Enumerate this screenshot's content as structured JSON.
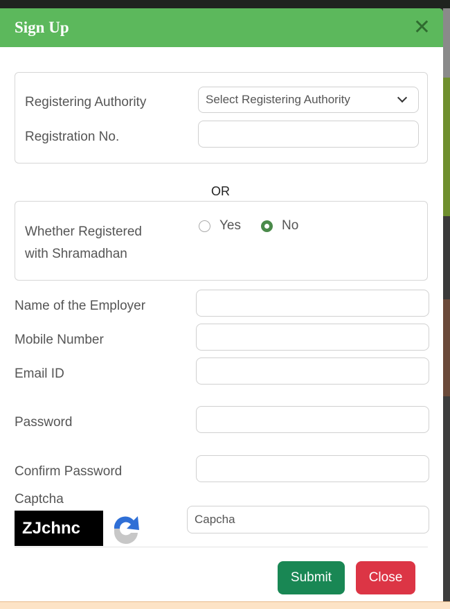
{
  "modal": {
    "title": "Sign Up",
    "close_icon": "close-icon"
  },
  "registration": {
    "authority_label": "Registering Authority",
    "authority_select_value": "Select Registering Authority",
    "regno_label": "Registration No.",
    "regno_value": ""
  },
  "or_text": "OR",
  "shramadhan": {
    "label_line1": "Whether Registered",
    "label_line2": "with Shramadhan",
    "options": [
      {
        "label": "Yes",
        "selected": false
      },
      {
        "label": "No",
        "selected": true
      }
    ],
    "accent_color": "#4a8a4a"
  },
  "fields": [
    {
      "label": "Name of the Employer",
      "value": ""
    },
    {
      "label": "Mobile Number",
      "value": ""
    },
    {
      "label": "Email ID",
      "value": ""
    },
    {
      "label": "Password",
      "value": ""
    },
    {
      "label": "Confirm Password",
      "value": ""
    }
  ],
  "captcha": {
    "label": "Captcha",
    "code": "ZJchnc",
    "refresh_icon": "refresh-icon",
    "input_placeholder": "Capcha"
  },
  "buttons": {
    "submit": "Submit",
    "close": "Close"
  },
  "colors": {
    "header": "#5cb85c",
    "submit": "#198754",
    "close": "#dc3545"
  }
}
